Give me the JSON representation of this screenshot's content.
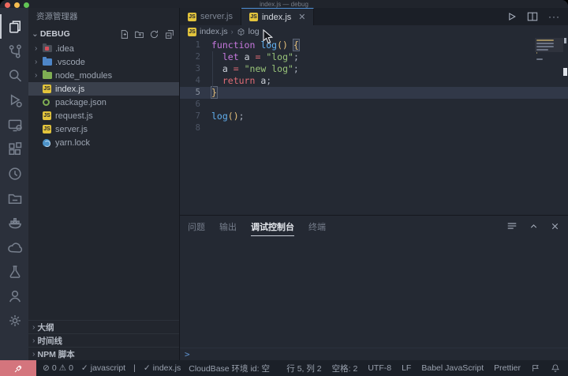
{
  "window": {
    "title": "index.js — debug"
  },
  "activity_bar": {
    "items": [
      {
        "name": "explorer",
        "active": true
      },
      {
        "name": "source-control",
        "active": false
      },
      {
        "name": "search",
        "active": false
      },
      {
        "name": "run-debug",
        "active": false
      },
      {
        "name": "remote-explorer",
        "active": false
      },
      {
        "name": "extensions",
        "active": false
      },
      {
        "name": "history",
        "active": false
      },
      {
        "name": "deploy-folder",
        "active": false
      },
      {
        "name": "docker",
        "active": false
      },
      {
        "name": "cloud",
        "active": false
      },
      {
        "name": "test-flask",
        "active": false
      },
      {
        "name": "account",
        "active": false
      },
      {
        "name": "settings-gear",
        "active": false
      }
    ]
  },
  "sidebar": {
    "title": "资源管理器",
    "section": {
      "label": "DEBUG",
      "actions": [
        "new-file",
        "new-folder",
        "refresh",
        "collapse-all"
      ]
    },
    "tree": [
      {
        "label": ".idea",
        "kind": "folder",
        "icon": "idea",
        "selected": false
      },
      {
        "label": ".vscode",
        "kind": "folder",
        "icon": "vscode",
        "selected": false
      },
      {
        "label": "node_modules",
        "kind": "folder",
        "icon": "node",
        "selected": false
      },
      {
        "label": "index.js",
        "kind": "file",
        "icon": "js",
        "selected": true
      },
      {
        "label": "package.json",
        "kind": "file",
        "icon": "npm",
        "selected": false
      },
      {
        "label": "request.js",
        "kind": "file",
        "icon": "js",
        "selected": false
      },
      {
        "label": "server.js",
        "kind": "file",
        "icon": "js",
        "selected": false
      },
      {
        "label": "yarn.lock",
        "kind": "file",
        "icon": "yarn",
        "selected": false
      }
    ],
    "bottom_sections": [
      {
        "label": "大纲"
      },
      {
        "label": "时间线"
      },
      {
        "label": "NPM 脚本"
      }
    ]
  },
  "editor": {
    "tabs": [
      {
        "label": "server.js",
        "active": false,
        "closable": false
      },
      {
        "label": "index.js",
        "active": true,
        "closable": true
      }
    ],
    "breadcrumb": {
      "file": "index.js",
      "symbol": "log"
    },
    "code": {
      "lines": [
        {
          "n": "1",
          "tokens": [
            [
              "function ",
              "kw"
            ],
            [
              "log",
              "fn"
            ],
            [
              "()",
              "br"
            ],
            [
              " ",
              "fg"
            ],
            [
              "{",
              "brm"
            ]
          ]
        },
        {
          "n": "2",
          "tokens": [
            [
              "  ",
              "fg"
            ],
            [
              "let",
              "kw"
            ],
            [
              " ",
              "fg"
            ],
            [
              "a",
              "vr"
            ],
            [
              " ",
              "fg"
            ],
            [
              "=",
              "op"
            ],
            [
              " ",
              "fg"
            ],
            [
              "\"log\"",
              "str"
            ],
            [
              ";",
              "fg"
            ]
          ]
        },
        {
          "n": "3",
          "tokens": [
            [
              "  ",
              "fg"
            ],
            [
              "a",
              "vr"
            ],
            [
              " ",
              "fg"
            ],
            [
              "=",
              "op"
            ],
            [
              " ",
              "fg"
            ],
            [
              "\"new log\"",
              "str"
            ],
            [
              ";",
              "fg"
            ]
          ]
        },
        {
          "n": "4",
          "tokens": [
            [
              "  ",
              "fg"
            ],
            [
              "return",
              "op"
            ],
            [
              " ",
              "fg"
            ],
            [
              "a",
              "vr"
            ],
            [
              ";",
              "fg"
            ]
          ]
        },
        {
          "n": "5",
          "tokens": [
            [
              "}",
              "brm"
            ]
          ],
          "cursor": true,
          "current": true
        },
        {
          "n": "6",
          "tokens": []
        },
        {
          "n": "7",
          "tokens": [
            [
              "log",
              "fn"
            ],
            [
              "()",
              "br"
            ],
            [
              ";",
              "fg"
            ]
          ]
        },
        {
          "n": "8",
          "tokens": []
        }
      ]
    }
  },
  "panel": {
    "tabs": [
      {
        "label": "问题",
        "active": false
      },
      {
        "label": "输出",
        "active": false
      },
      {
        "label": "调试控制台",
        "active": true
      },
      {
        "label": "终端",
        "active": false
      }
    ],
    "input_prompt": ">"
  },
  "status_bar": {
    "left": [
      {
        "type": "diagnostics",
        "errors": "0",
        "warnings": "0"
      },
      {
        "type": "check",
        "label": "javascript"
      },
      {
        "type": "sep",
        "label": "|"
      },
      {
        "type": "check",
        "label": "index.js"
      },
      {
        "type": "text",
        "label": "CloudBase 环境 id: 空"
      }
    ],
    "right": [
      {
        "type": "text",
        "label": "行 5, 列 2"
      },
      {
        "type": "text",
        "label": "空格: 2"
      },
      {
        "type": "text",
        "label": "UTF-8"
      },
      {
        "type": "text",
        "label": "LF"
      },
      {
        "type": "text",
        "label": "Babel JavaScript"
      },
      {
        "type": "text",
        "label": "Prettier"
      },
      {
        "type": "icon",
        "name": "feedback"
      },
      {
        "type": "icon",
        "name": "bell"
      }
    ]
  },
  "colors": {
    "accent": "#4e8fd5",
    "remote_badge": "#d4757d",
    "keyword": "#c678dd",
    "function": "#61afef",
    "string": "#98c379",
    "bracket": "#e5c07b",
    "operator": "#e06c75",
    "traffic_red": "#ee6a5f",
    "traffic_yellow": "#f5bd4f",
    "traffic_green": "#61c455"
  }
}
